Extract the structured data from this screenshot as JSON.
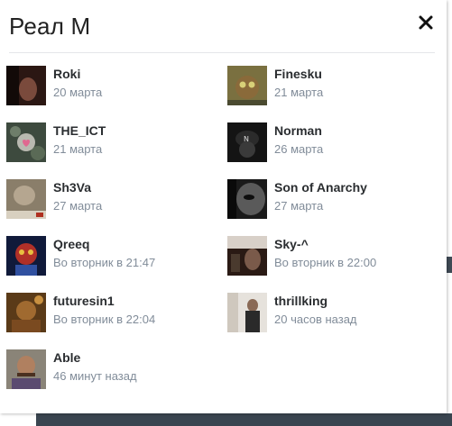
{
  "modal": {
    "title": "Реал М",
    "close_icon": "close-icon"
  },
  "members": [
    {
      "name": "Roki",
      "time": "20 марта"
    },
    {
      "name": "Finesku",
      "time": "21 марта"
    },
    {
      "name": "THE_ICT",
      "time": "21 марта"
    },
    {
      "name": "Norman",
      "time": "26 марта"
    },
    {
      "name": "Sh3Va",
      "time": "27 марта"
    },
    {
      "name": "Son of Anarchy",
      "time": "27 марта"
    },
    {
      "name": "Qreeq",
      "time": "Во вторник в 21:47"
    },
    {
      "name": "Sky-^",
      "time": "Во вторник в 22:00"
    },
    {
      "name": "futuresin1",
      "time": "Во вторник в 22:04"
    },
    {
      "name": "thrillking",
      "time": "20 часов назад"
    },
    {
      "name": "Able",
      "time": "46 минут назад"
    }
  ],
  "colors": {
    "name": "#2a2d30",
    "time": "#818c99",
    "divider": "#e4e6e9"
  }
}
